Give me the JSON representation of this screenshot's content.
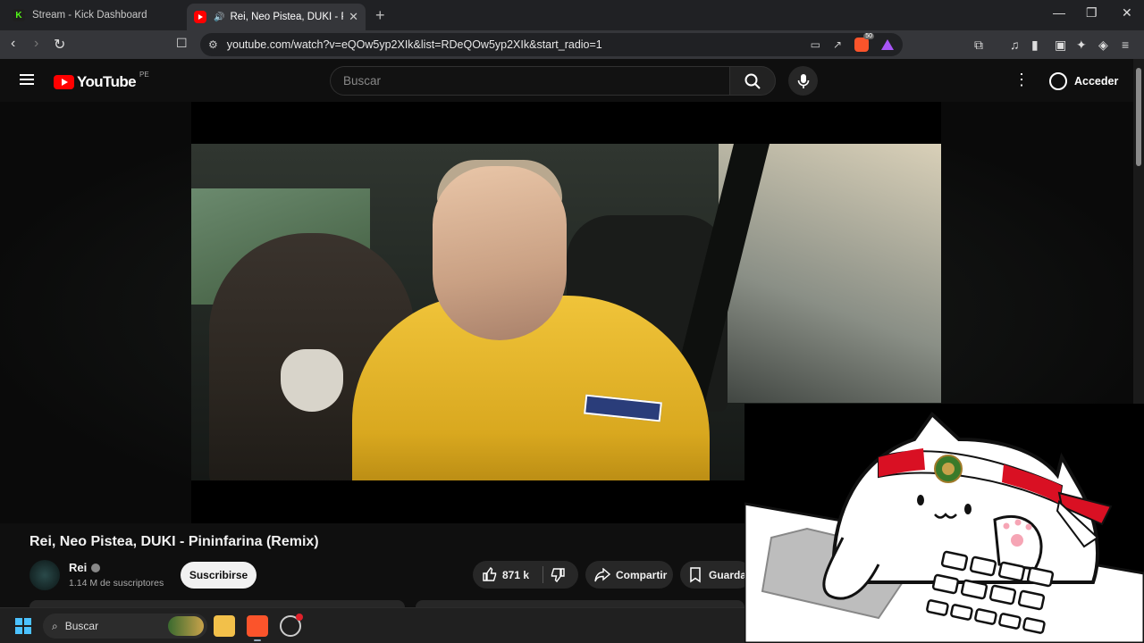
{
  "browser": {
    "tabs": [
      {
        "title": "Stream - Kick Dashboard",
        "favicon": "kick-icon"
      },
      {
        "title": "Rei, Neo Pistea, DUKI - Pininfarina",
        "favicon": "youtube-icon",
        "active": true
      }
    ],
    "url": "youtube.com/watch?v=eQOw5yp2XIk&list=RDeQOw5yp2XIk&start_radio=1",
    "brave_badge": "50"
  },
  "youtube": {
    "logo_text": "YouTube",
    "country_code": "PE",
    "search_placeholder": "Buscar",
    "signin_label": "Acceder"
  },
  "video": {
    "title": "Rei, Neo Pistea, DUKI - Pininfarina (Remix)",
    "channel": "Rei",
    "subscribers": "1.14 M de suscriptores",
    "subscribe_label": "Suscribirse",
    "likes": "871 k",
    "share_label": "Compartir",
    "save_label": "Guardar"
  },
  "taskbar": {
    "search_label": "Buscar"
  },
  "colors": {
    "youtube_red": "#ff0000",
    "background": "#0f0f0f",
    "chrome_tabbar": "#202124",
    "chrome_toolbar": "#35363a",
    "kick_green": "#53fc18",
    "brave_orange": "#fb542b"
  }
}
